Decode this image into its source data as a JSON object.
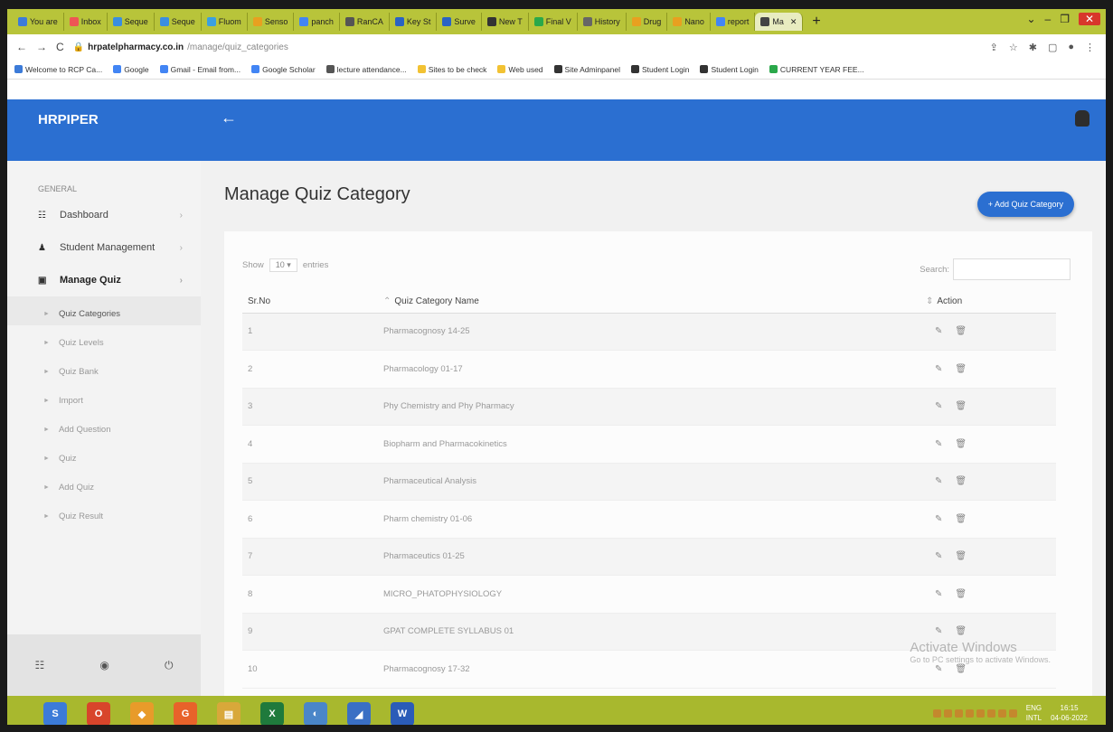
{
  "browser": {
    "tabs": [
      {
        "label": "You are",
        "color": "#3c7bd8"
      },
      {
        "label": "Inbox",
        "color": "#e55"
      },
      {
        "label": "Seque",
        "color": "#3a8ee0"
      },
      {
        "label": "Seque",
        "color": "#3a8ee0"
      },
      {
        "label": "Fluom",
        "color": "#3aa0e0"
      },
      {
        "label": "Senso",
        "color": "#e8a020"
      },
      {
        "label": "panch",
        "color": "#4285f4"
      },
      {
        "label": "RanCA",
        "color": "#555"
      },
      {
        "label": "Key St",
        "color": "#2a63c4"
      },
      {
        "label": "Surve",
        "color": "#2a63c4"
      },
      {
        "label": "New T",
        "color": "#333"
      },
      {
        "label": "Final V",
        "color": "#2aa84a"
      },
      {
        "label": "History",
        "color": "#666"
      },
      {
        "label": "Drug",
        "color": "#e8a020"
      },
      {
        "label": "Nano",
        "color": "#e8a020"
      },
      {
        "label": "report",
        "color": "#4285f4"
      },
      {
        "label": "Ma",
        "color": "#444"
      }
    ],
    "url_host": "hrpatelpharmacy.co.in",
    "url_path": "/manage/quiz_categories",
    "bookmarks": [
      {
        "label": "Welcome to RCP Ca...",
        "color": "#3c7bd8"
      },
      {
        "label": "Google",
        "color": "#4285f4"
      },
      {
        "label": "Gmail - Email from...",
        "color": "#4285f4"
      },
      {
        "label": "Google Scholar",
        "color": "#4285f4"
      },
      {
        "label": "lecture attendance...",
        "color": "#555"
      },
      {
        "label": "Sites to be check",
        "color": "#f2c233"
      },
      {
        "label": "Web used",
        "color": "#f2c233"
      },
      {
        "label": "Site Adminpanel",
        "color": "#333"
      },
      {
        "label": "Student Login",
        "color": "#333"
      },
      {
        "label": "Student Login",
        "color": "#333"
      },
      {
        "label": "CURRENT YEAR FEE...",
        "color": "#2aa84a"
      }
    ]
  },
  "header": {
    "brand": "HRPIPER",
    "back_icon": "←"
  },
  "sidebar": {
    "section": "GENERAL",
    "items": [
      {
        "label": "Dashboard",
        "icon": "☷"
      },
      {
        "label": "Student Management",
        "icon": "♟"
      },
      {
        "label": "Manage Quiz",
        "icon": "▣"
      }
    ],
    "subitems": [
      "Quiz Categories",
      "Quiz Levels",
      "Quiz Bank",
      "Import",
      "Add Question",
      "Quiz",
      "Add Quiz",
      "Quiz Result"
    ],
    "footer_icons": [
      "☷",
      "◉",
      "⏻"
    ]
  },
  "main": {
    "title": "Manage Quiz Category",
    "add_button": "+ Add Quiz Category",
    "show_label": "Show",
    "entries_value": "10",
    "entries_label": "entries",
    "search_label": "Search:",
    "columns": [
      "Sr.No",
      "Quiz Category Name",
      "Action"
    ],
    "rows": [
      {
        "no": "1",
        "name": "Pharmacognosy 14-25"
      },
      {
        "no": "2",
        "name": "Pharmacology 01-17"
      },
      {
        "no": "3",
        "name": "Phy Chemistry and Phy Pharmacy"
      },
      {
        "no": "4",
        "name": "Biopharm and Pharmacokinetics"
      },
      {
        "no": "5",
        "name": "Pharmaceutical Analysis"
      },
      {
        "no": "6",
        "name": "Pharm chemistry 01-06"
      },
      {
        "no": "7",
        "name": "Pharmaceutics 01-25"
      },
      {
        "no": "8",
        "name": "MICRO_PHATOPHYSIOLOGY"
      },
      {
        "no": "9",
        "name": "GPAT COMPLETE SYLLABUS 01"
      },
      {
        "no": "10",
        "name": "Pharmacognosy 17-32"
      }
    ]
  },
  "watermark": {
    "line1": "Activate Windows",
    "line2": "Go to PC settings to activate Windows."
  },
  "taskbar": {
    "lang": "ENG",
    "lang2": "INTL",
    "time": "16:15",
    "date": "04-06-2022",
    "apps": [
      {
        "glyph": "S",
        "color": "#3c7bd8"
      },
      {
        "glyph": "O",
        "color": "#d8452b"
      },
      {
        "glyph": "◆",
        "color": "#e89b2a"
      },
      {
        "glyph": "G",
        "color": "#e8622a"
      },
      {
        "glyph": "▤",
        "color": "#d8a83a"
      },
      {
        "glyph": "X",
        "color": "#1f7a3c"
      },
      {
        "glyph": "◐",
        "color": "#4a86c8"
      },
      {
        "glyph": "◢",
        "color": "#3a6fc4"
      },
      {
        "glyph": "W",
        "color": "#2b5cb8"
      }
    ]
  }
}
